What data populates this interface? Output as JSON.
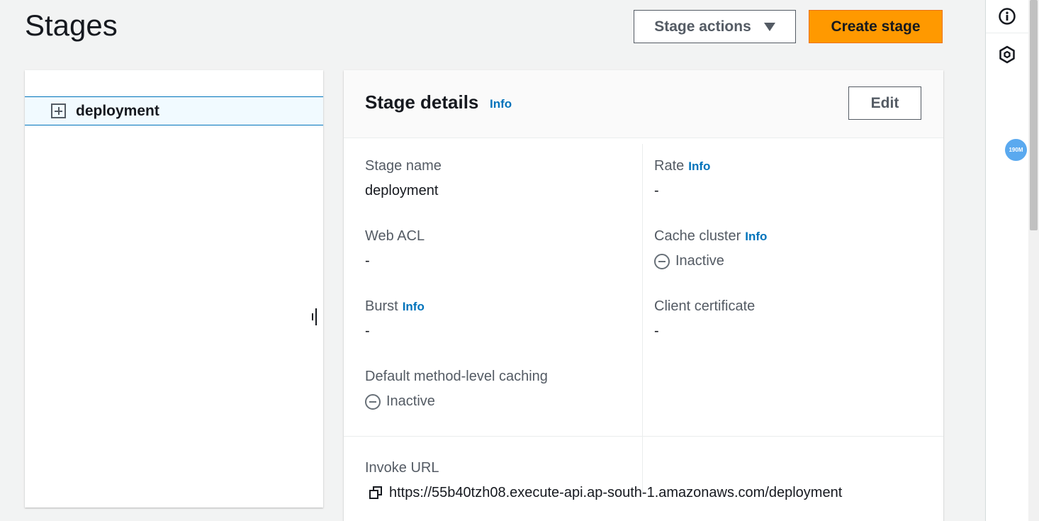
{
  "header": {
    "title": "Stages",
    "stage_actions_label": "Stage actions",
    "create_stage_label": "Create stage"
  },
  "tree": {
    "items": [
      {
        "label": "deployment",
        "icon": "plus-square-icon"
      }
    ]
  },
  "details": {
    "title": "Stage details",
    "info_label": "Info",
    "edit_label": "Edit",
    "fields": {
      "stage_name": {
        "label": "Stage name",
        "value": "deployment"
      },
      "rate": {
        "label": "Rate",
        "info": "Info",
        "value": "-"
      },
      "web_acl": {
        "label": "Web ACL",
        "value": "-"
      },
      "cache_cluster": {
        "label": "Cache cluster",
        "info": "Info",
        "value": "Inactive",
        "icon": "minus-circle-icon"
      },
      "burst": {
        "label": "Burst",
        "info": "Info",
        "value": "-"
      },
      "client_certificate": {
        "label": "Client certificate",
        "value": "-"
      },
      "default_caching": {
        "label": "Default method-level caching",
        "value": "Inactive",
        "icon": "minus-circle-icon"
      }
    },
    "invoke_url": {
      "label": "Invoke URL",
      "value": "https://55b40tzh08.execute-api.ap-south-1.amazonaws.com/deployment",
      "icon": "copy-icon"
    }
  },
  "right_rail": {
    "icons": [
      "info-circle-icon",
      "hexagon-settings-icon"
    ],
    "badge": "190M"
  },
  "colors": {
    "primary_button": "#ff9900",
    "link": "#0073bb",
    "selected_row_bg": "#f1faff",
    "selected_row_border": "#0073bb"
  }
}
